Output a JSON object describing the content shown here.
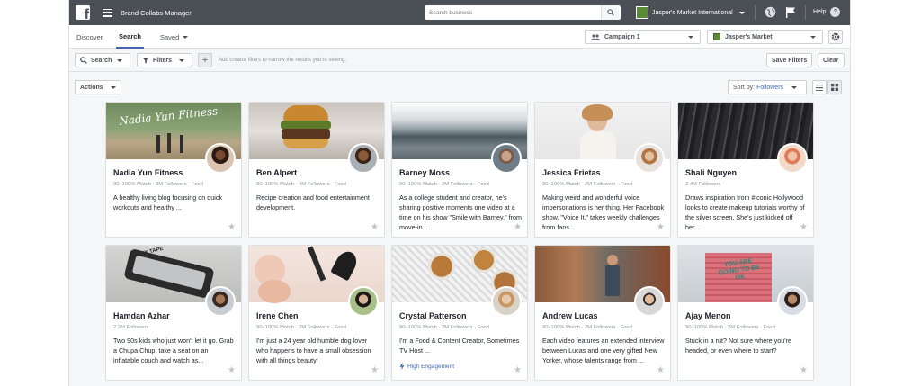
{
  "app": {
    "logo_letter": "f",
    "title": "Brand Collabs Manager",
    "search_placeholder": "Search business",
    "account_name": "Jasper's Market International",
    "help_label": "Help"
  },
  "nav": {
    "tabs": [
      {
        "label": "Discover"
      },
      {
        "label": "Search"
      },
      {
        "label": "Saved"
      }
    ],
    "campaign_label": "Campaign 1",
    "page_label": "Jasper's Market"
  },
  "filters": {
    "search_label": "Search",
    "filters_label": "Filters",
    "hint": "Add creator filters to narrow the results you're seeing.",
    "save_label": "Save Filters",
    "clear_label": "Clear"
  },
  "actions": {
    "actions_label": "Actions",
    "sort_prefix": "Sort by:",
    "sort_value": "Followers"
  },
  "creators": [
    {
      "name": "Nadia Yun Fitness",
      "meta": "90–100% Match · 8M Followers · Food",
      "desc": "A healthy living blog focusing on quick workouts and healthy ...",
      "hero_text": "Nadia Yun Fitness"
    },
    {
      "name": "Ben Alpert",
      "meta": "90–100% Match · 4M Followers · Food",
      "desc": "Recipe creation and food entertainment development."
    },
    {
      "name": "Barney Moss",
      "meta": "90–100% Match · 2M Followers · Food",
      "desc": "As a college student and creator, he's sharing positive moments one video at a time on his show \"Smile with Barney,\" from move-in..."
    },
    {
      "name": "Jessica Frietas",
      "meta": "90–100% Match · 2M Followers · Food",
      "desc": "Making weird and wonderful voice impersonations is her thing. Her Facebook show, \"Voice It,\" takes weekly challenges from fans..."
    },
    {
      "name": "Shali Nguyen",
      "meta": "2.4M Followers",
      "desc": "Draws inspiration from #iconic Hollywood looks to create makeup tutorials worthy of the silver screen. She's just kicked off her..."
    },
    {
      "name": "Hamdan Azhar",
      "meta": "2.2M Followers",
      "desc": "Two 90s kids who just won't let it go. Grab a Chupa Chup, take a seat on an inflatable couch and watch as...",
      "hero_text": "MIX TAPE"
    },
    {
      "name": "Irene Chen",
      "meta": "90–100% Match · 2M Followers · Food",
      "desc": "I'm just a 24 year old humble dog lover who happens to have a small obsession with all things beauty!"
    },
    {
      "name": "Crystal Patterson",
      "meta": "90–100% Match · 2M Followers · Food",
      "desc": "I'm a Food & Content Creator, Sometimes TV Host ...",
      "badge": "High Engagement"
    },
    {
      "name": "Andrew Lucas",
      "meta": "90–100% Match · 2M Followers · Food",
      "desc": "Each video features an extended interview between Lucas and one very gifted New Yorker, whose talents range from ..."
    },
    {
      "name": "Ajay Menon",
      "meta": "90–100% Match · 2M Followers · Food",
      "desc": "Stuck in a rut? Not sure where you're headed, or even where to start?",
      "hero_text": "YOU ARE GOING TO BE OK"
    }
  ],
  "colors": {
    "topbar": "#4b4f56",
    "accent": "#4267b2",
    "page_bg": "#f5f6f7"
  }
}
